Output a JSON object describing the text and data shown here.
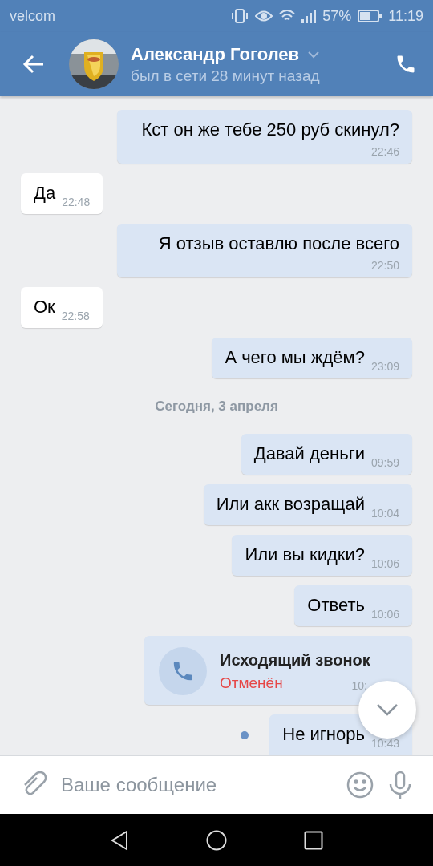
{
  "status_bar": {
    "carrier": "velcom",
    "battery": "57%",
    "time": "11:19"
  },
  "header": {
    "name": "Александр Гоголев",
    "last_seen": "был в сети 28 минут назад"
  },
  "messages": [
    {
      "kind": "text",
      "outgoing": true,
      "unread": false,
      "text": "Кст он же тебе 250 руб скинул?",
      "time": "22:46"
    },
    {
      "kind": "text",
      "outgoing": false,
      "unread": false,
      "text": "Да",
      "time": "22:48"
    },
    {
      "kind": "text",
      "outgoing": true,
      "unread": false,
      "text": "Я отзыв оставлю после всего",
      "time": "22:50"
    },
    {
      "kind": "text",
      "outgoing": false,
      "unread": false,
      "text": "Ок",
      "time": "22:58"
    },
    {
      "kind": "text",
      "outgoing": true,
      "unread": false,
      "text": "А чего мы ждём?",
      "time": "23:09"
    },
    {
      "kind": "date",
      "text": "Сегодня, 3 апреля"
    },
    {
      "kind": "text",
      "outgoing": true,
      "unread": false,
      "text": "Давай деньги",
      "time": "09:59"
    },
    {
      "kind": "text",
      "outgoing": true,
      "unread": false,
      "text": "Или акк возращай",
      "time": "10:04"
    },
    {
      "kind": "text",
      "outgoing": true,
      "unread": false,
      "text": "Или вы кидки?",
      "time": "10:06"
    },
    {
      "kind": "text",
      "outgoing": true,
      "unread": false,
      "text": "Ответь",
      "time": "10:06"
    },
    {
      "kind": "call",
      "outgoing": true,
      "title": "Исходящий звонок",
      "status": "Отменён",
      "time": "10:"
    },
    {
      "kind": "text",
      "outgoing": true,
      "unread": true,
      "text": "Не игнорь",
      "time": "10:43"
    }
  ],
  "composer": {
    "placeholder": "Ваше сообщение"
  }
}
